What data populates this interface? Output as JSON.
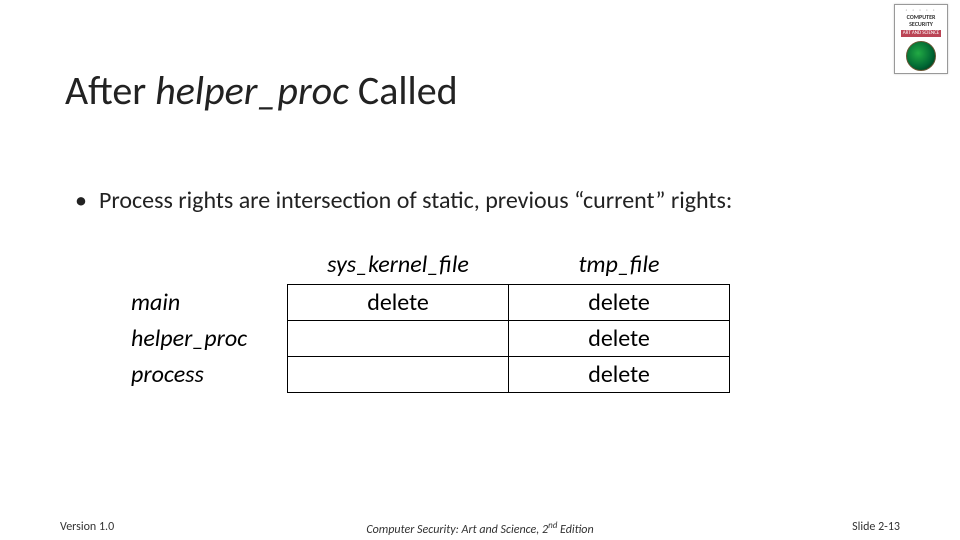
{
  "title": {
    "pre": "After ",
    "ital": "helper_proc",
    "post": " Called"
  },
  "bullet": {
    "dot": "•",
    "text": "Process rights are intersection of static, previous “current” rights:"
  },
  "table": {
    "col1": "sys_kernel_file",
    "col2": "tmp_file",
    "rows": [
      {
        "label": "main",
        "c1": "delete",
        "c2": "delete"
      },
      {
        "label": "helper_proc",
        "c1": "",
        "c2": "delete"
      },
      {
        "label": "process",
        "c1": "",
        "c2": "delete"
      }
    ]
  },
  "footer": {
    "version": "Version 1.0",
    "book_pre": "Computer Security: Art and Science, 2",
    "book_sup": "nd",
    "book_post": " Edition",
    "page": "Slide 2-13"
  },
  "logo": {
    "line1": "COMPUTER",
    "line2": "SECURITY",
    "sub": "ART AND SCIENCE"
  },
  "chart_data": {
    "type": "table",
    "title": "Process rights are intersection of static, previous “current” rights",
    "columns": [
      "",
      "sys_kernel_file",
      "tmp_file"
    ],
    "rows": [
      [
        "main",
        "delete",
        "delete"
      ],
      [
        "helper_proc",
        "",
        "delete"
      ],
      [
        "process",
        "",
        "delete"
      ]
    ]
  }
}
